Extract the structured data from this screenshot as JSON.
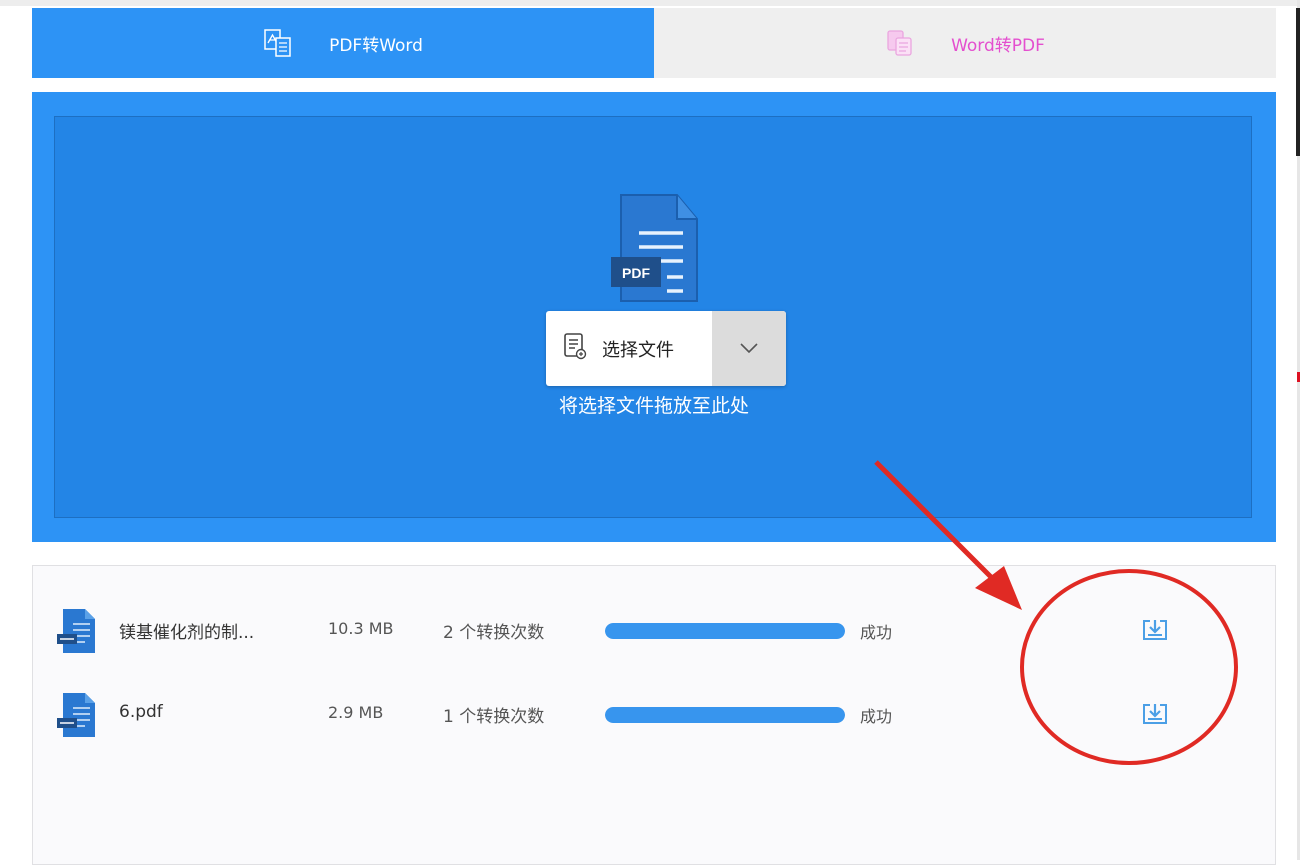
{
  "colors": {
    "primary": "#2d93f5",
    "drop_inner": "#2385e6",
    "inactive_tab_bg": "#efefef",
    "inactive_tab_text": "#e44fcf",
    "progress": "#3795ee",
    "annotation": "#e02a24"
  },
  "tabs": [
    {
      "label": "PDF转Word",
      "icon": "pdf-to-word-icon",
      "active": true
    },
    {
      "label": "Word转PDF",
      "icon": "word-to-pdf-icon",
      "active": false
    }
  ],
  "upload": {
    "file_icon": "pdf-file-icon",
    "file_icon_label": "PDF",
    "select_button": "选择文件",
    "select_icon": "document-icon",
    "dropdown_icon": "chevron-down-icon",
    "drop_hint": "将选择文件拖放至此处"
  },
  "files": [
    {
      "name": "镁基催化剂的制...",
      "size": "10.3 MB",
      "conversions": "2 个转换次数",
      "progress": 1.0,
      "status": "成功",
      "action_icon": "download-icon"
    },
    {
      "name": "6.pdf",
      "size": "2.9 MB",
      "conversions": "1 个转换次数",
      "progress": 1.0,
      "status": "成功",
      "action_icon": "download-icon"
    }
  ],
  "annotation": {
    "shapes": [
      "red-arrow",
      "red-circle"
    ]
  }
}
